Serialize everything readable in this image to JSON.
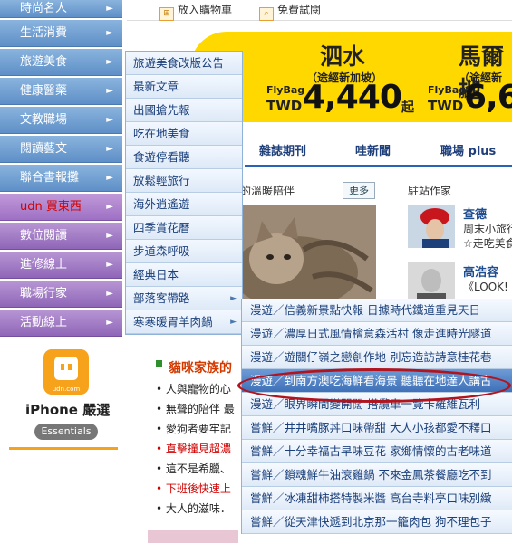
{
  "left_menu": [
    {
      "label": "時尚名人"
    },
    {
      "label": "生活消費"
    },
    {
      "label": "旅遊美食"
    },
    {
      "label": "健康醫藥"
    },
    {
      "label": "文教職場"
    },
    {
      "label": "閱讀藝文"
    },
    {
      "label": "聯合書報攤"
    },
    {
      "label": "udn 買東西"
    },
    {
      "label": "數位閱讀"
    },
    {
      "label": "進修線上"
    },
    {
      "label": "職場行家"
    },
    {
      "label": "活動線上"
    }
  ],
  "iphone_promo": {
    "logo_text": "udn.com",
    "title": "iPhone 嚴選",
    "pill": "Essentials"
  },
  "toolbar": {
    "cart": "放入購物車",
    "trial": "免費試閱"
  },
  "banner": {
    "left": {
      "city": "泗水",
      "sub": "（途經新加坡）",
      "flybag": "FlyBag",
      "currency": "TWD",
      "price": "4,440",
      "qi": "起"
    },
    "right": {
      "city": "馬爾地",
      "sub": "（途經新加",
      "flybag": "FlyBag",
      "currency": "TWD",
      "price": "6,6"
    }
  },
  "nav": {
    "tab1": "雜誌期刊",
    "tab2": "哇新聞",
    "tab3": "職場 plus"
  },
  "content": {
    "cat_heading": "的溫暖陪伴",
    "more": "更多",
    "writers_heading": "駐站作家",
    "writer1": {
      "name": "查德",
      "desc1": "周末小旅行",
      "desc2": "☆走吃美食"
    },
    "writer2": {
      "name": "高浩容",
      "desc1": "《LOOK!"
    },
    "cat_family": "貓咪家族的",
    "bullets": [
      "人與寵物的心",
      "無聲的陪伴 最",
      "愛狗者要牢記",
      "直擊撞見超濃",
      "這不是希臘、",
      "下班後快速上",
      "大人的滋味．"
    ]
  },
  "submenu1": [
    {
      "label": "旅遊美食改版公告"
    },
    {
      "label": "最新文章"
    },
    {
      "label": "出國搶先報"
    },
    {
      "label": "吃在地美食"
    },
    {
      "label": "食遊停看聽"
    },
    {
      "label": "放鬆輕旅行"
    },
    {
      "label": "海外逍遙遊"
    },
    {
      "label": "四季賞花曆"
    },
    {
      "label": "步道森呼吸"
    },
    {
      "label": "經典日本"
    },
    {
      "label": "部落客帶路"
    },
    {
      "label": "寒寒暖胃羊肉鍋"
    }
  ],
  "submenu2": [
    {
      "label": "漫遊／信義新景點快報 日據時代鐵道重見天日"
    },
    {
      "label": "漫遊／濃厚日式風情檜意森活村 像走進時光隧道"
    },
    {
      "label": "漫遊／遊關仔嶺之戀創作地 別忘造訪詩意桂花巷"
    },
    {
      "label": "漫遊／到南方澳吃海鮮看海景 聽聽在地達人講古"
    },
    {
      "label": "漫遊／眼界瞬間變開闊 搭纜車一覽卡羅維瓦利"
    },
    {
      "label": "嘗鮮／井井嘴豚丼口味帶甜 大人小孩都愛不釋口"
    },
    {
      "label": "嘗鮮／十分幸福古早味豆花 家鄉情懷的古老味道"
    },
    {
      "label": "嘗鮮／鎖魂鮮牛油滾雞鍋 不來金鳳茶餐廳吃不到"
    },
    {
      "label": "嘗鮮／冰凍甜柿搭特製米醬 高台寺料亭口味別緻"
    },
    {
      "label": "嘗鮮／從天津快遞到北京那一籠肉包 狗不理包子"
    }
  ],
  "arrow": "►"
}
